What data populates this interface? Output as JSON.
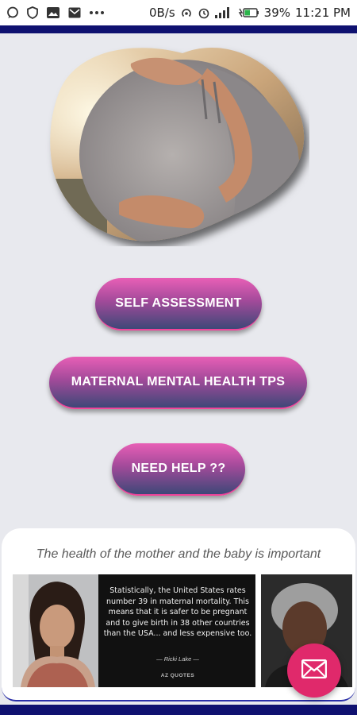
{
  "status_bar": {
    "network_speed": "0B/s",
    "battery": "39%",
    "time": "11:21 PM"
  },
  "buttons": {
    "self_assessment": "SELF ASSESSMENT",
    "maternal_tips": "MATERNAL MENTAL HEALTH TPS",
    "need_help": "NEED HELP  ??"
  },
  "card": {
    "tagline": "The health of the mother and the baby is important",
    "quote_text": "Statistically, the United States rates number 39 in maternal mortality. This means that it is safer to be pregnant and to give birth in 38 other countries than the USA... and less expensive too.",
    "quote_author": "— Ricki Lake —",
    "quote_brand": "AZ QUOTES"
  },
  "colors": {
    "accent_band": "#0f1170",
    "button_top": "#e85fb6",
    "button_bottom": "#3e4878",
    "fab": "#e0296b"
  },
  "icons": {
    "fab": "mail-icon"
  }
}
